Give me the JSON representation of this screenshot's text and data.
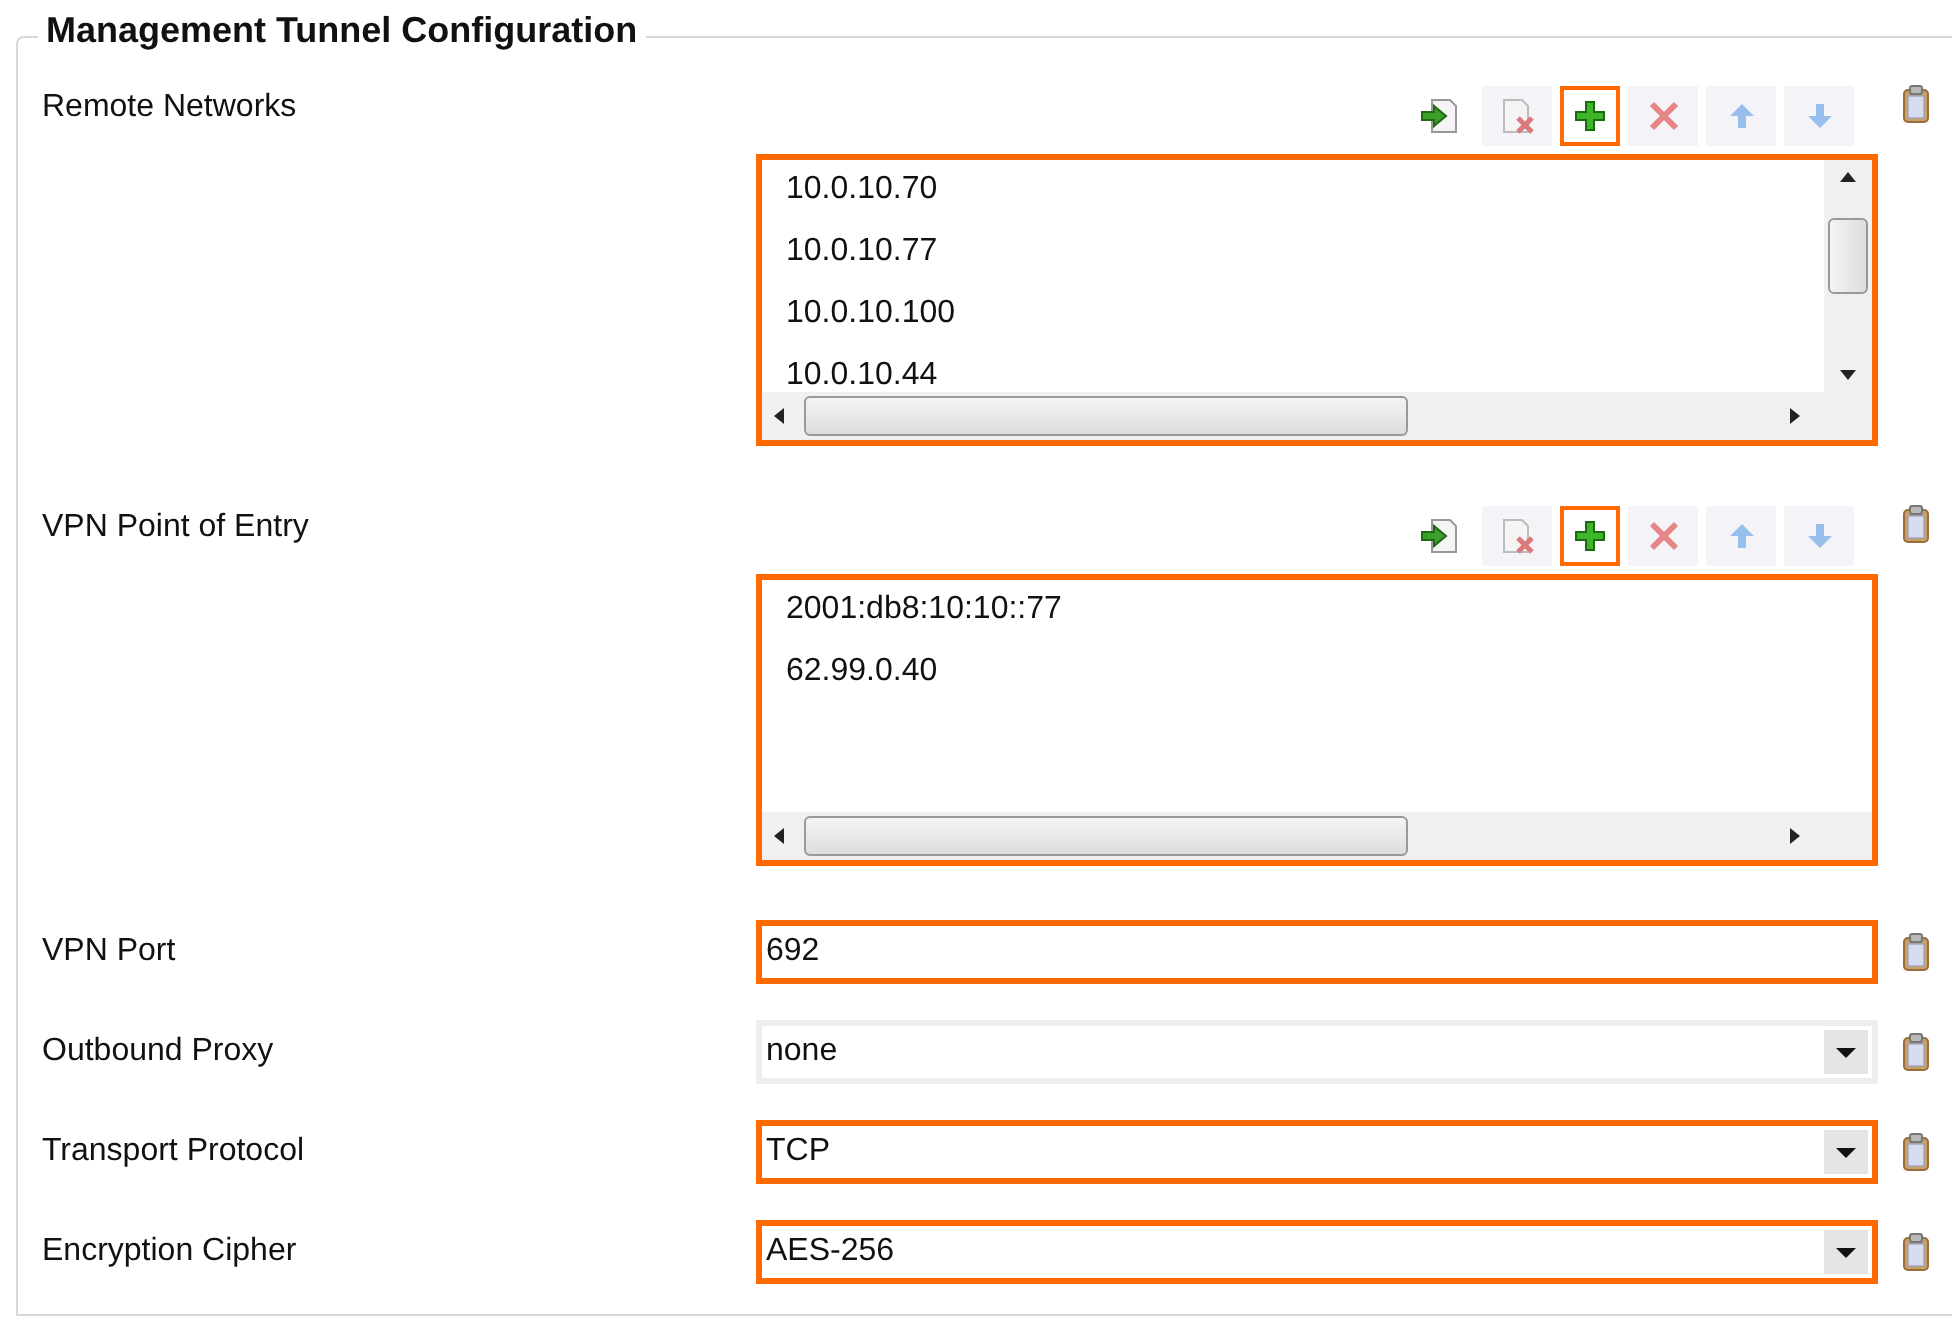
{
  "group": {
    "title": "Management Tunnel Configuration"
  },
  "lists": [
    {
      "label": "Remote Networks",
      "highlighted": true,
      "vertical_scrollbar": true,
      "items": [
        "10.0.10.70",
        "10.0.10.77",
        "10.0.10.100",
        "10.0.10.44"
      ],
      "toolbar": [
        {
          "kind": "import",
          "disabled": false,
          "highlighted": false
        },
        {
          "kind": "remove-file",
          "disabled": true,
          "highlighted": false
        },
        {
          "kind": "add",
          "disabled": false,
          "highlighted": true
        },
        {
          "kind": "delete",
          "disabled": true,
          "highlighted": false
        },
        {
          "kind": "up",
          "disabled": true,
          "highlighted": false
        },
        {
          "kind": "down",
          "disabled": true,
          "highlighted": false
        }
      ]
    },
    {
      "label": "VPN Point of Entry",
      "highlighted": true,
      "vertical_scrollbar": false,
      "items": [
        "2001:db8:10:10::77",
        "62.99.0.40"
      ],
      "toolbar": [
        {
          "kind": "import",
          "disabled": false,
          "highlighted": false
        },
        {
          "kind": "remove-file",
          "disabled": true,
          "highlighted": false
        },
        {
          "kind": "add",
          "disabled": false,
          "highlighted": true
        },
        {
          "kind": "delete",
          "disabled": true,
          "highlighted": false
        },
        {
          "kind": "up",
          "disabled": true,
          "highlighted": false
        },
        {
          "kind": "down",
          "disabled": true,
          "highlighted": false
        }
      ]
    }
  ],
  "fields": [
    {
      "label": "VPN Port",
      "kind": "text",
      "value": "692",
      "highlighted": true
    },
    {
      "label": "Outbound Proxy",
      "kind": "select",
      "value": "none",
      "highlighted": false
    },
    {
      "label": "Transport Protocol",
      "kind": "select",
      "value": "TCP",
      "highlighted": true
    },
    {
      "label": "Encryption Cipher",
      "kind": "select",
      "value": "AES-256",
      "highlighted": true
    }
  ]
}
